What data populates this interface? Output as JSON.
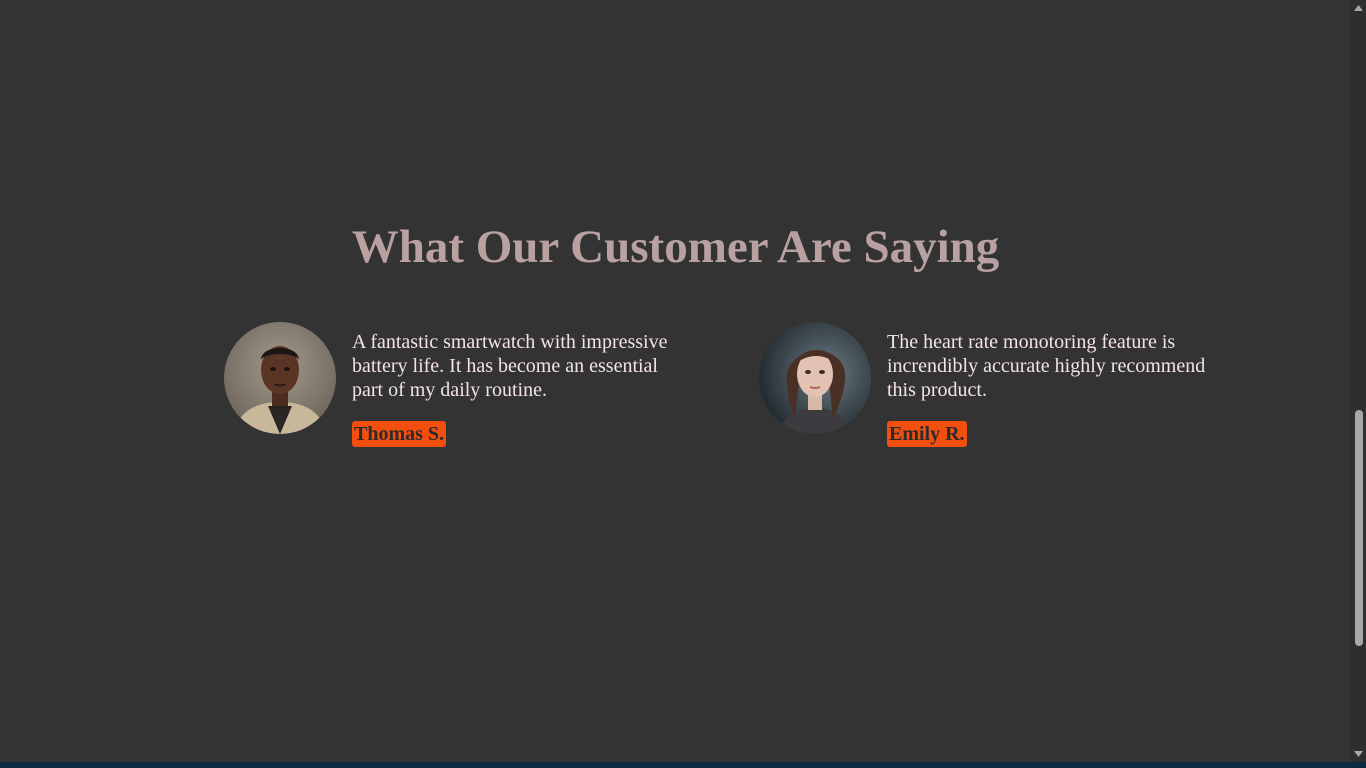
{
  "section": {
    "title": "What Our Customer Are Saying"
  },
  "testimonials": [
    {
      "quote": "A fantastic smartwatch with impressive battery life. It has become an essential part of my daily routine.",
      "name": "Thomas S.",
      "avatar": "avatar-man-photo"
    },
    {
      "quote": "The heart rate monotoring feature is increndibly accurate highly recommend this product.",
      "name": "Emily R.",
      "avatar": "avatar-woman-photo"
    }
  ],
  "colors": {
    "background": "#333333",
    "title": "#b9a1a1",
    "quote_text": "#f3e3e3",
    "name_badge": "#f24f0f",
    "bottom_strip": "#0f2940"
  },
  "scrollbar": {
    "up_icon": "scroll-up-arrow-icon",
    "down_icon": "scroll-down-arrow-icon"
  }
}
